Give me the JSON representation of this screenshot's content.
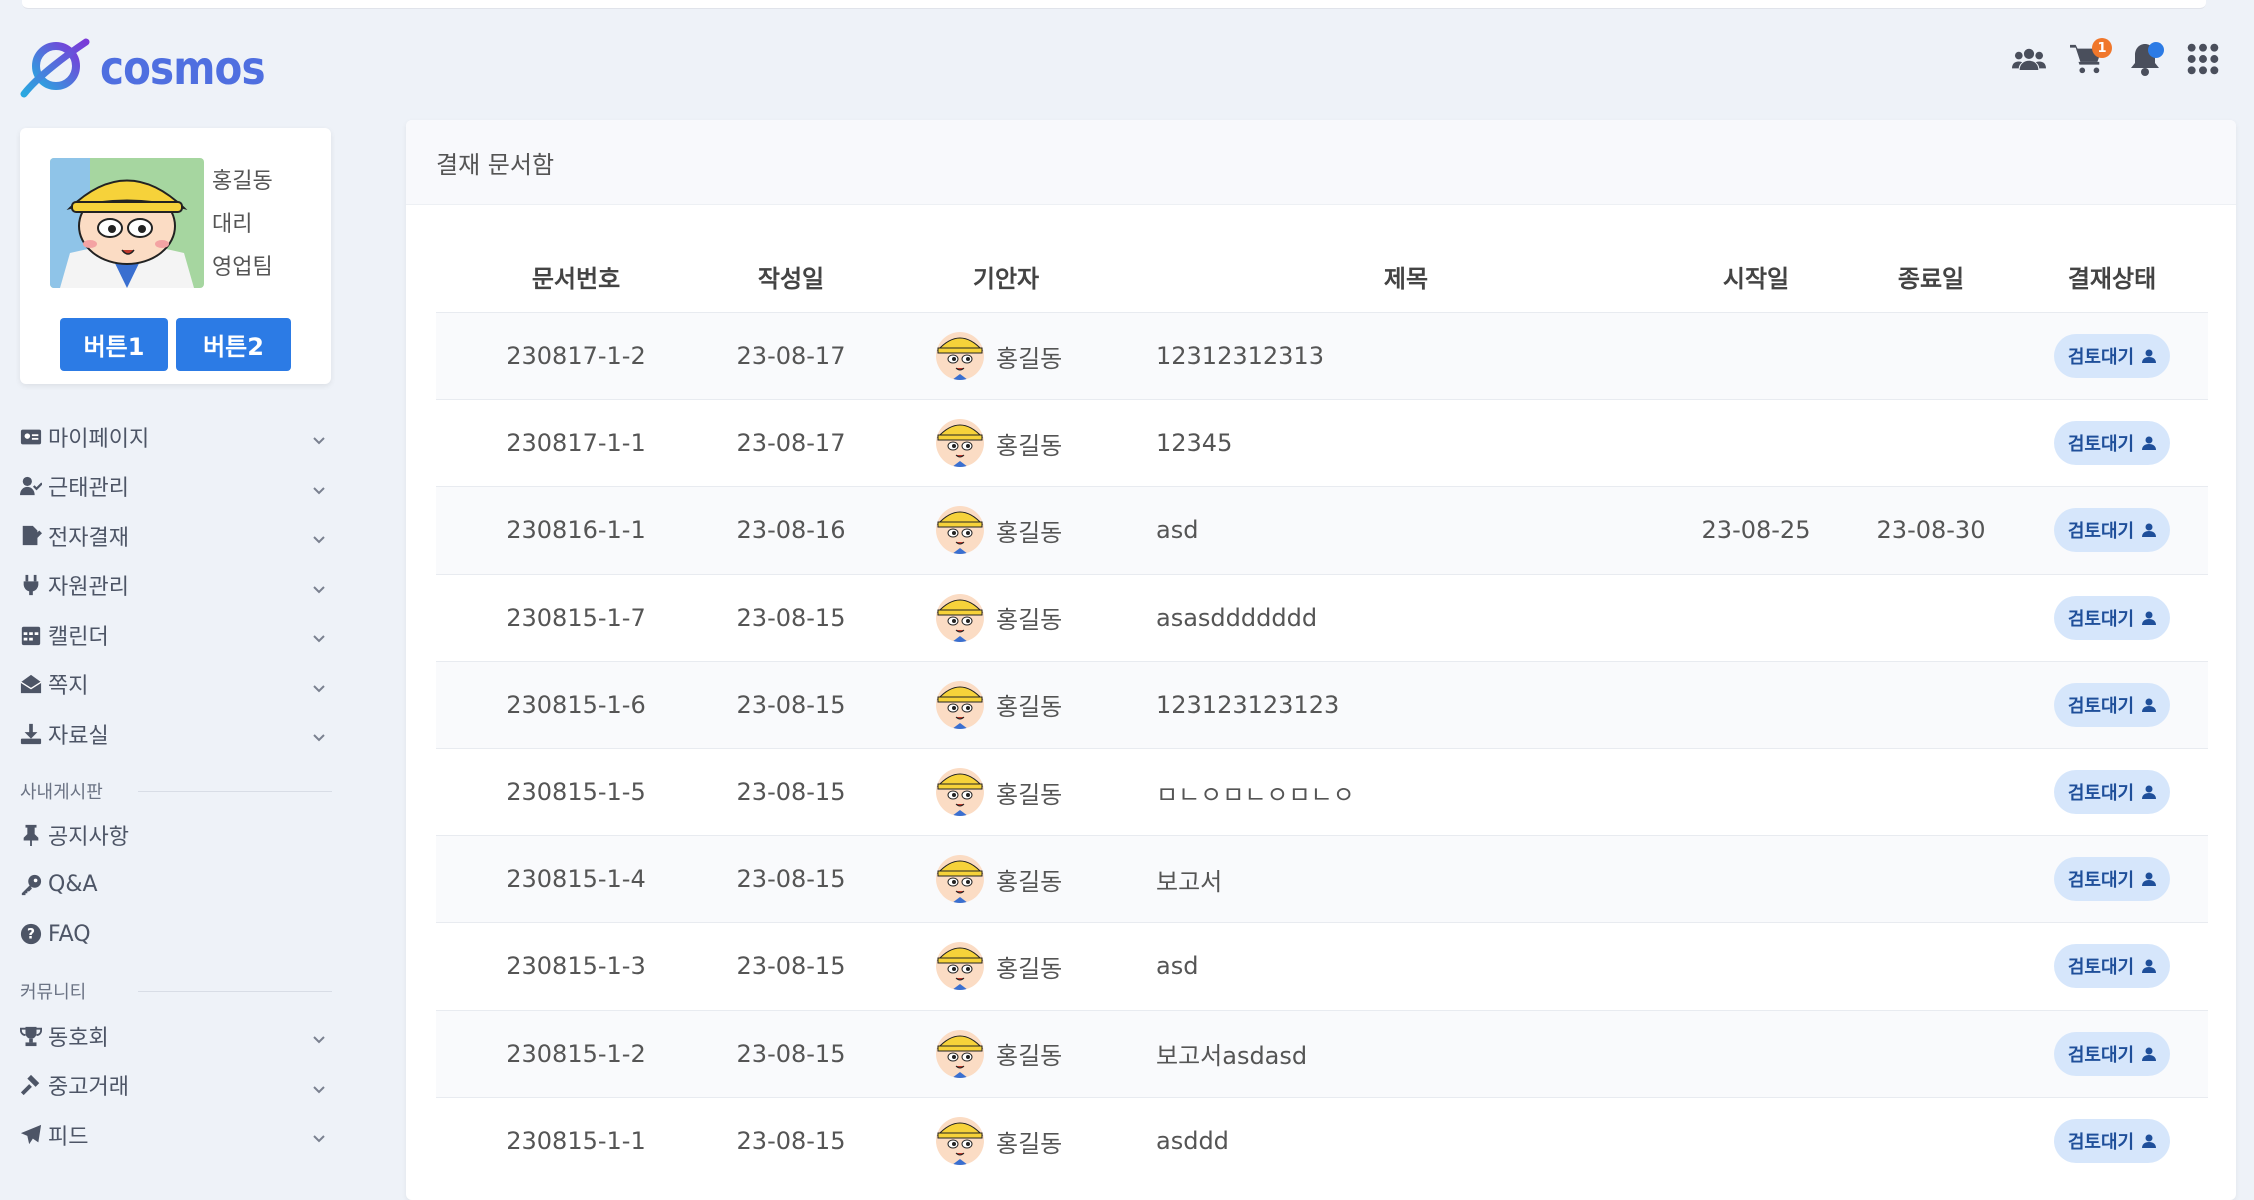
{
  "app": {
    "brand": "cosmos",
    "colors": {
      "accent": "#2c7be5",
      "badge": "#f0772b",
      "status_bg": "#d6e6fb"
    }
  },
  "header": {
    "icons": [
      "users-icon",
      "cart-icon",
      "bell-icon",
      "apps-grid-icon"
    ],
    "cart_badge": "1"
  },
  "profile": {
    "name": "홍길동",
    "position": "대리",
    "team": "영업팀",
    "button1": "버튼1",
    "button2": "버튼2"
  },
  "sidebar": {
    "items": [
      {
        "label": "마이페이지",
        "icon": "id-card-icon"
      },
      {
        "label": "근태관리",
        "icon": "user-check-icon"
      },
      {
        "label": "전자결재",
        "icon": "file-sign-icon"
      },
      {
        "label": "자원관리",
        "icon": "plug-icon"
      },
      {
        "label": "캘린더",
        "icon": "calendar-icon"
      },
      {
        "label": "쪽지",
        "icon": "envelope-open-icon"
      },
      {
        "label": "자료실",
        "icon": "download-icon"
      }
    ],
    "board_section": "사내게시판",
    "board_items": [
      {
        "label": "공지사항",
        "icon": "thumbtack-icon"
      },
      {
        "label": "Q&A",
        "icon": "key-icon"
      },
      {
        "label": "FAQ",
        "icon": "question-circle-icon"
      }
    ],
    "community_section": "커뮤니티",
    "community_items": [
      {
        "label": "동호회",
        "icon": "trophy-icon"
      },
      {
        "label": "중고거래",
        "icon": "gavel-icon"
      },
      {
        "label": "피드",
        "icon": "paper-plane-icon"
      }
    ]
  },
  "main": {
    "title": "결재 문서함",
    "columns": [
      "문서번호",
      "작성일",
      "기안자",
      "제목",
      "시작일",
      "종료일",
      "결재상태"
    ],
    "rows": [
      {
        "doc_no": "230817-1-2",
        "date": "23-08-17",
        "drafter": "홍길동",
        "title": "12312312313",
        "start": "",
        "end": "",
        "status": "검토대기"
      },
      {
        "doc_no": "230817-1-1",
        "date": "23-08-17",
        "drafter": "홍길동",
        "title": "12345",
        "start": "",
        "end": "",
        "status": "검토대기"
      },
      {
        "doc_no": "230816-1-1",
        "date": "23-08-16",
        "drafter": "홍길동",
        "title": "asd",
        "start": "23-08-25",
        "end": "23-08-30",
        "status": "검토대기"
      },
      {
        "doc_no": "230815-1-7",
        "date": "23-08-15",
        "drafter": "홍길동",
        "title": "asasddddddd",
        "start": "",
        "end": "",
        "status": "검토대기"
      },
      {
        "doc_no": "230815-1-6",
        "date": "23-08-15",
        "drafter": "홍길동",
        "title": "123123123123",
        "start": "",
        "end": "",
        "status": "검토대기"
      },
      {
        "doc_no": "230815-1-5",
        "date": "23-08-15",
        "drafter": "홍길동",
        "title": "ㅁㄴㅇㅁㄴㅇㅁㄴㅇ",
        "start": "",
        "end": "",
        "status": "검토대기"
      },
      {
        "doc_no": "230815-1-4",
        "date": "23-08-15",
        "drafter": "홍길동",
        "title": "보고서",
        "start": "",
        "end": "",
        "status": "검토대기"
      },
      {
        "doc_no": "230815-1-3",
        "date": "23-08-15",
        "drafter": "홍길동",
        "title": "asd",
        "start": "",
        "end": "",
        "status": "검토대기"
      },
      {
        "doc_no": "230815-1-2",
        "date": "23-08-15",
        "drafter": "홍길동",
        "title": "보고서asdasd",
        "start": "",
        "end": "",
        "status": "검토대기"
      },
      {
        "doc_no": "230815-1-1",
        "date": "23-08-15",
        "drafter": "홍길동",
        "title": "asddd",
        "start": "",
        "end": "",
        "status": "검토대기"
      }
    ]
  }
}
